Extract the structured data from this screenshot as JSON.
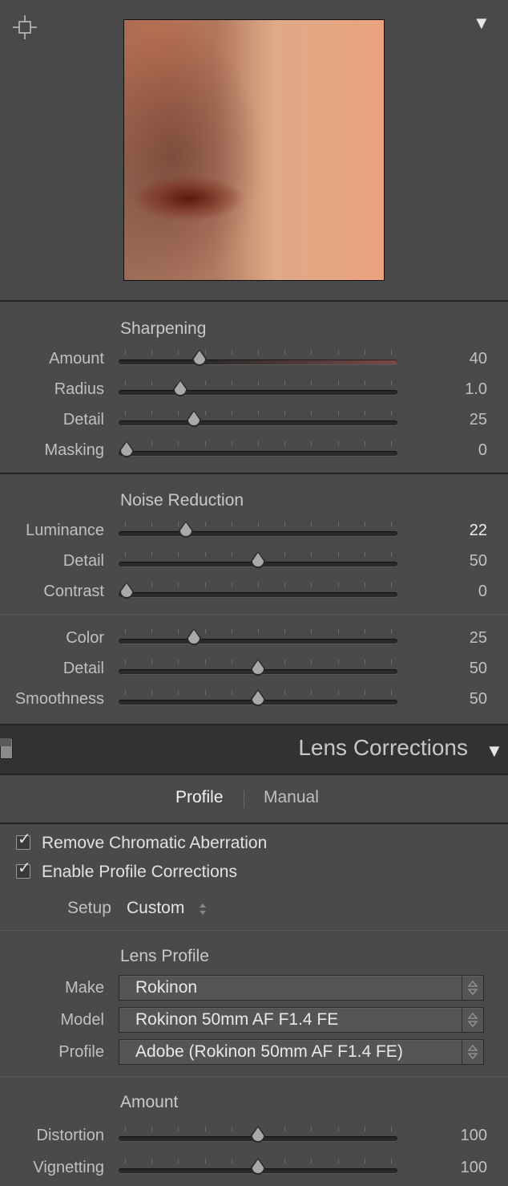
{
  "preview": {
    "menu_icon": "triangle-down-icon",
    "target_icon": "target-adjust-icon"
  },
  "sharpening": {
    "title": "Sharpening",
    "rows": [
      {
        "label": "Amount",
        "value": "40",
        "pos": 0.29,
        "bright": false
      },
      {
        "label": "Radius",
        "value": "1.0",
        "pos": 0.22,
        "bright": false
      },
      {
        "label": "Detail",
        "value": "25",
        "pos": 0.27,
        "bright": false
      },
      {
        "label": "Masking",
        "value": "0",
        "pos": 0.03,
        "bright": false
      }
    ]
  },
  "noise_reduction": {
    "title": "Noise Reduction",
    "rows": [
      {
        "label": "Luminance",
        "value": "22",
        "pos": 0.24,
        "bright": true
      },
      {
        "label": "Detail",
        "value": "50",
        "pos": 0.5,
        "bright": false
      },
      {
        "label": "Contrast",
        "value": "0",
        "pos": 0.03,
        "bright": false
      }
    ],
    "color_rows": [
      {
        "label": "Color",
        "value": "25",
        "pos": 0.27,
        "bright": false
      },
      {
        "label": "Detail",
        "value": "50",
        "pos": 0.5,
        "bright": false
      },
      {
        "label": "Smoothness",
        "value": "50",
        "pos": 0.5,
        "bright": false
      }
    ]
  },
  "lens_corrections": {
    "title": "Lens Corrections",
    "tabs": [
      "Profile",
      "Manual"
    ],
    "active_tab": "Profile",
    "checkboxes": [
      {
        "label": "Remove Chromatic Aberration",
        "checked": true
      },
      {
        "label": "Enable Profile Corrections",
        "checked": true
      }
    ],
    "setup": {
      "label": "Setup",
      "value": "Custom"
    },
    "lens_profile": {
      "title": "Lens Profile",
      "make": {
        "label": "Make",
        "value": "Rokinon"
      },
      "model": {
        "label": "Model",
        "value": "Rokinon 50mm AF F1.4 FE"
      },
      "profile": {
        "label": "Profile",
        "value": "Adobe (Rokinon 50mm AF F1.4 FE)"
      }
    },
    "amount": {
      "title": "Amount",
      "rows": [
        {
          "label": "Distortion",
          "value": "100",
          "pos": 0.5,
          "bright": false
        },
        {
          "label": "Vignetting",
          "value": "100",
          "pos": 0.5,
          "bright": false
        }
      ]
    }
  },
  "colors": {
    "amount_track_accent": "#7a4a4a",
    "background": "#4a4a4a",
    "header": "#323232"
  }
}
